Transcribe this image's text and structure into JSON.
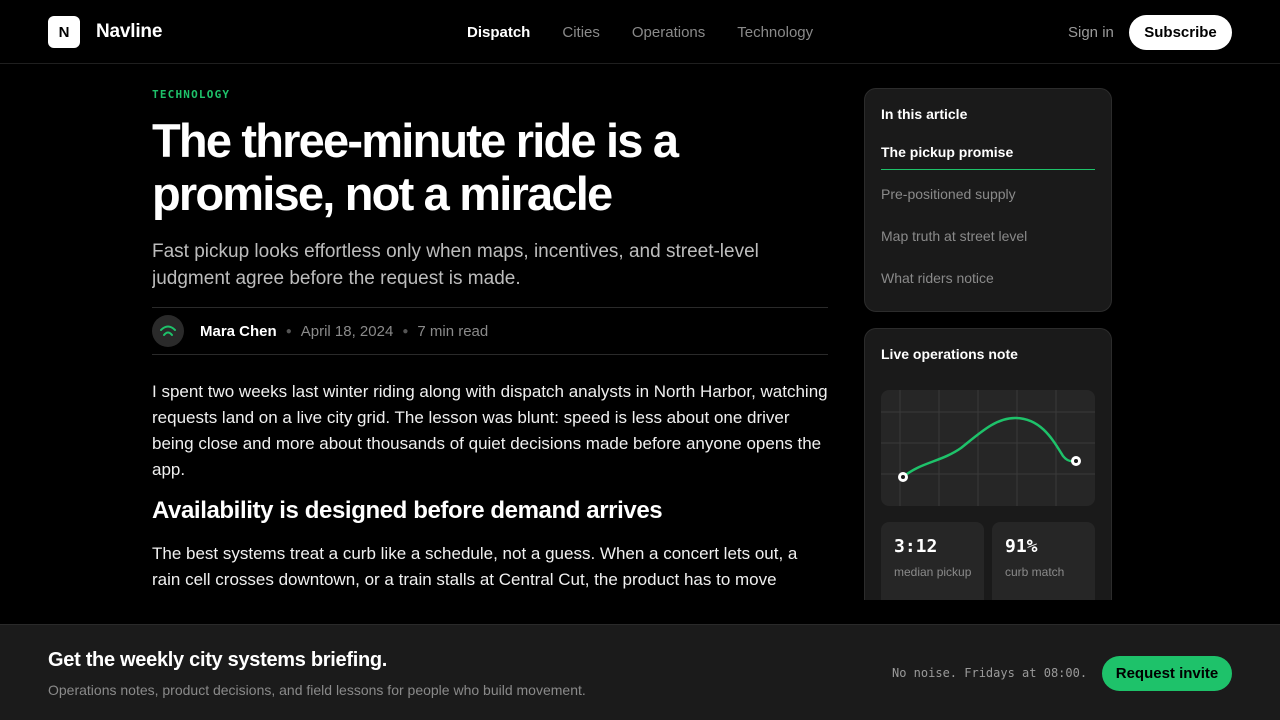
{
  "header": {
    "logo_letter": "N",
    "brand": "Navline",
    "nav": [
      "Dispatch",
      "Cities",
      "Operations",
      "Technology"
    ],
    "active_nav": "Dispatch",
    "sign_in": "Sign in",
    "subscribe": "Subscribe"
  },
  "article": {
    "kicker": "TECHNOLOGY",
    "title": "The three-minute ride is a promise, not a miracle",
    "dek": "Fast pickup looks effortless only when maps, incentives, and street-level judgment agree before the request is made.",
    "author": "Mara Chen",
    "date": "April 18, 2024",
    "read_time": "7 min read",
    "p1": "I spent two weeks last winter riding along with dispatch analysts in North Harbor, watching requests land on a live city grid. The lesson was blunt: speed is less about one driver being close and more about thousands of quiet decisions made before anyone opens the app.",
    "h2": "Availability is designed before demand arrives",
    "p2": "The best systems treat a curb like a schedule, not a guess. When a concert lets out, a rain cell crosses downtown, or a train stalls at Central Cut, the product has to move"
  },
  "toc": {
    "title": "In this article",
    "items": [
      "The pickup promise",
      "Pre-positioned supply",
      "Map truth at street level",
      "What riders notice"
    ],
    "active_index": 0
  },
  "ops": {
    "title": "Live operations note",
    "stats": [
      {
        "value": "3:12",
        "label": "median pickup"
      },
      {
        "value": "91%",
        "label": "curb match"
      }
    ],
    "accent": "#1ec26a"
  },
  "briefing": {
    "title": "Get the weekly city systems briefing.",
    "subtitle": "Operations notes, product decisions, and field lessons for people who build movement.",
    "note": "No noise. Fridays at 08:00.",
    "button": "Request invite"
  }
}
